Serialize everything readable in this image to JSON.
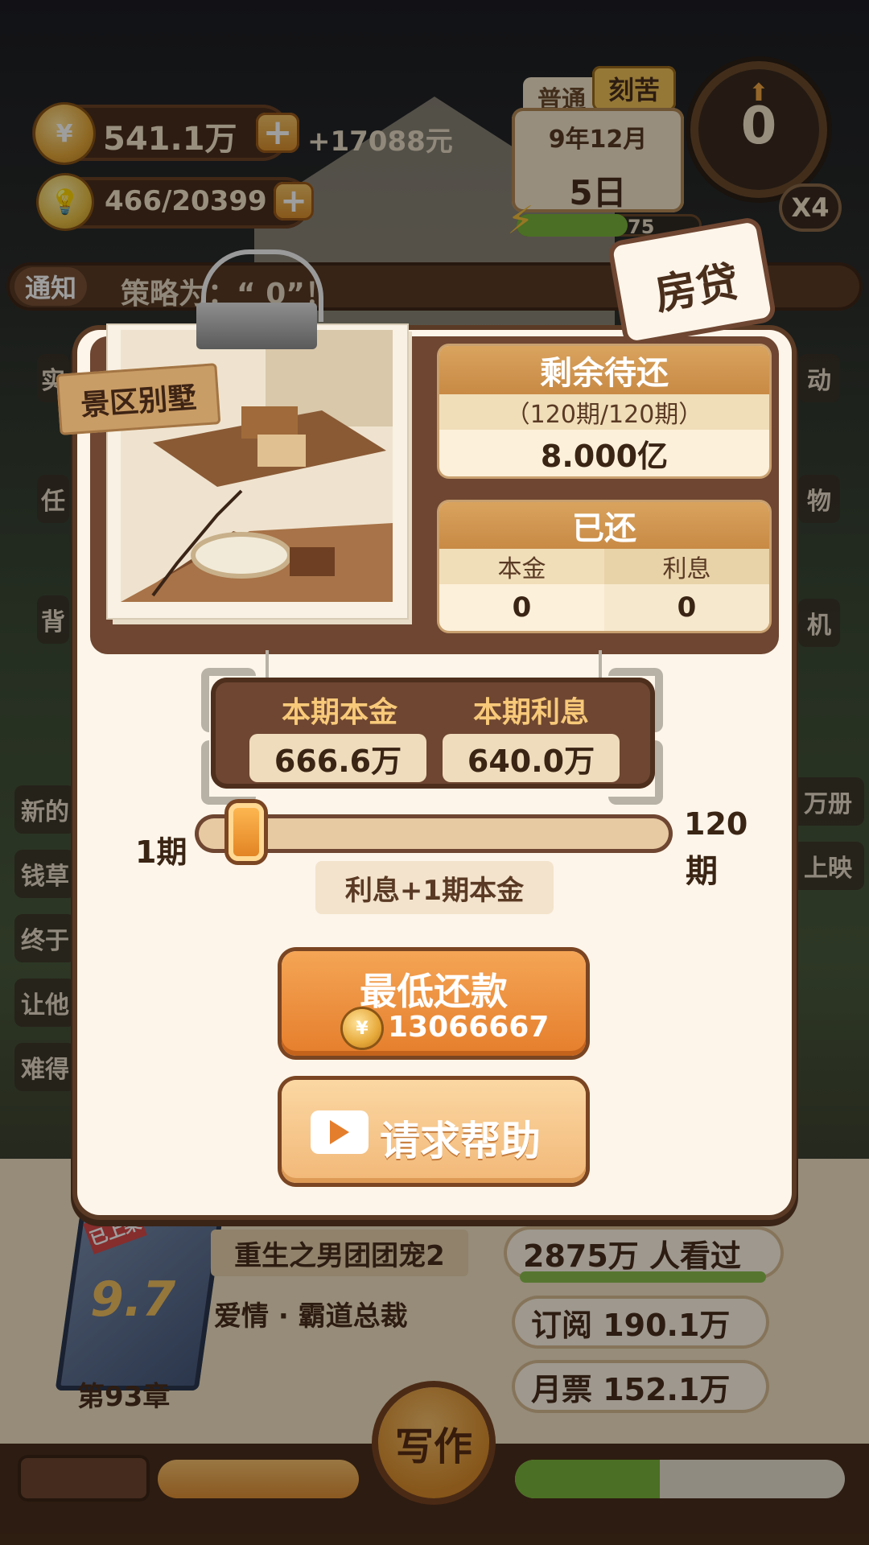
{
  "hud": {
    "money": "541.1万",
    "income": "+17088元",
    "energy": "466/20399",
    "mode_normal": "普通",
    "mode_hard": "刻苦",
    "year_month": "9年12月",
    "day": "5日",
    "clock_value": "0",
    "speed": "X4",
    "energy_bar_text": "75"
  },
  "notice": {
    "tag": "通知",
    "text": "策略为：“ 0”！"
  },
  "side_labels_left": [
    "实",
    "任",
    "背",
    "新的",
    "钱草",
    "终于",
    "让他",
    "难得"
  ],
  "side_labels_right": [
    "动",
    "物",
    "机",
    "万册",
    "上映"
  ],
  "modal": {
    "ribbon": "房贷",
    "property_name": "景区别墅",
    "remaining": {
      "title": "剩余待还",
      "periods": "（120期/120期）",
      "amount": "8.000亿"
    },
    "paid": {
      "title": "已还",
      "principal_label": "本金",
      "interest_label": "利息",
      "principal_value": "0",
      "interest_value": "0"
    },
    "current": {
      "principal_label": "本期本金",
      "interest_label": "本期利息",
      "principal_value": "666.6万",
      "interest_value": "640.0万"
    },
    "slider": {
      "min_label": "1期",
      "max_label_num": "120",
      "max_label_unit": "期",
      "value": 1,
      "hint": "利息+1期本金"
    },
    "pay_button": {
      "title": "最低还款",
      "amount": "13066667"
    },
    "help_button": {
      "label": "请求帮助"
    }
  },
  "novel": {
    "title": "重生之男团团宠2",
    "genre": "爱情 · 霸道总裁",
    "chapter": "第93章",
    "score": "9.7",
    "badge": "已上架",
    "views": "2875万 人看过",
    "subscribe": "订阅 190.1万",
    "monthly_ticket": "月票 152.1万"
  },
  "bottom": {
    "write_label": "写作"
  },
  "colors": {
    "accent_orange": "#e57e2c",
    "dark_brown": "#4a2e1c",
    "cream": "#fdf5ea"
  }
}
